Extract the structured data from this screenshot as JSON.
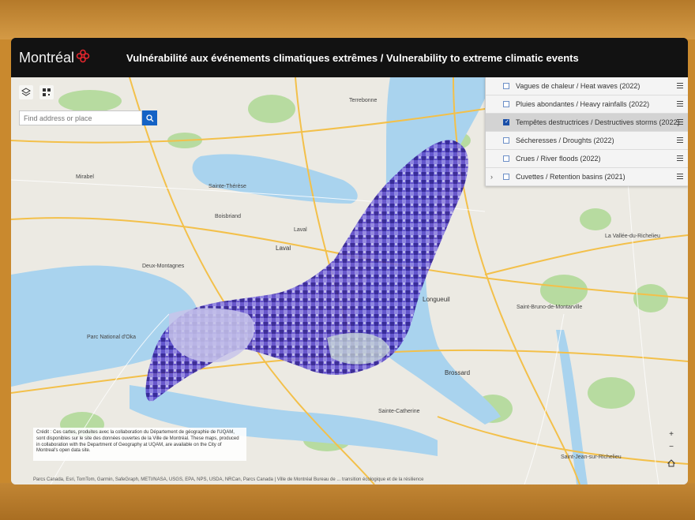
{
  "header": {
    "logo_text": "Montréal",
    "title": "Vulnérabilité aux événements climatiques extrêmes / Vulnerability to extreme climatic events"
  },
  "colors": {
    "header_bg": "#121212",
    "accent": "#1462c5",
    "logo_red": "#e0262d",
    "vulnerability_dark": "#2b1a8f",
    "vulnerability_light": "#b9b3ea",
    "water": "#a9d3ee",
    "park": "#b7dba0"
  },
  "icons": {
    "layers": "layers-icon",
    "qr": "qr-code-icon",
    "search": "search-icon",
    "menu": "list-menu-icon",
    "home": "home-icon"
  },
  "search": {
    "placeholder": "Find address or place"
  },
  "layers": [
    {
      "label": "Vagues de chaleur / Heat waves (2022)",
      "checked": false
    },
    {
      "label": "Pluies abondantes / Heavy rainfalls (2022)",
      "checked": false
    },
    {
      "label": "Tempêtes destructrices / Destructives storms (2022)",
      "checked": true
    },
    {
      "label": "Sécheresses / Droughts (2022)",
      "checked": false
    },
    {
      "label": "Crues / River floods (2022)",
      "checked": false
    },
    {
      "label": "Cuvettes / Retention basins (2021)",
      "checked": false,
      "expandable": true
    }
  ],
  "places": {
    "terrebonne": "Terrebonne",
    "mirabel": "Mirabel",
    "sainte_therese": "Sainte-Thérèse",
    "boisbriand": "Boisbriand",
    "laval_north": "Laval",
    "laval": "Laval",
    "deux_montagnes": "Deux-Montagnes",
    "longueuil": "Longueuil",
    "brossard": "Brossard",
    "sainte_catherine": "Sainte-Catherine",
    "saint_bruno": "Saint-Bruno-de-Montarville",
    "la_vallee": "La Vallée-du-Richelieu",
    "saint_jean": "Saint-Jean-sur-Richelieu",
    "parc_oka": "Parc National d'Oka"
  },
  "credit": "Crédit : Ces cartes, produites avec la collaboration du Département de géographie de l'UQAM, sont disponibles sur le site des données ouvertes de la Ville de Montréal. These maps, produced in collaboration with the Department of Geography at UQAM, are available on the City of Montreal's open data site.",
  "attribution": "Parcs Canada, Esri, TomTom, Garmin, SafeGraph, METI/NASA, USGS, EPA, NPS, USDA, NRCan, Parcs Canada | Ville de Montréal Bureau de ... transition écologique et de la résilience",
  "zoom": {
    "in": "+",
    "out": "−"
  }
}
